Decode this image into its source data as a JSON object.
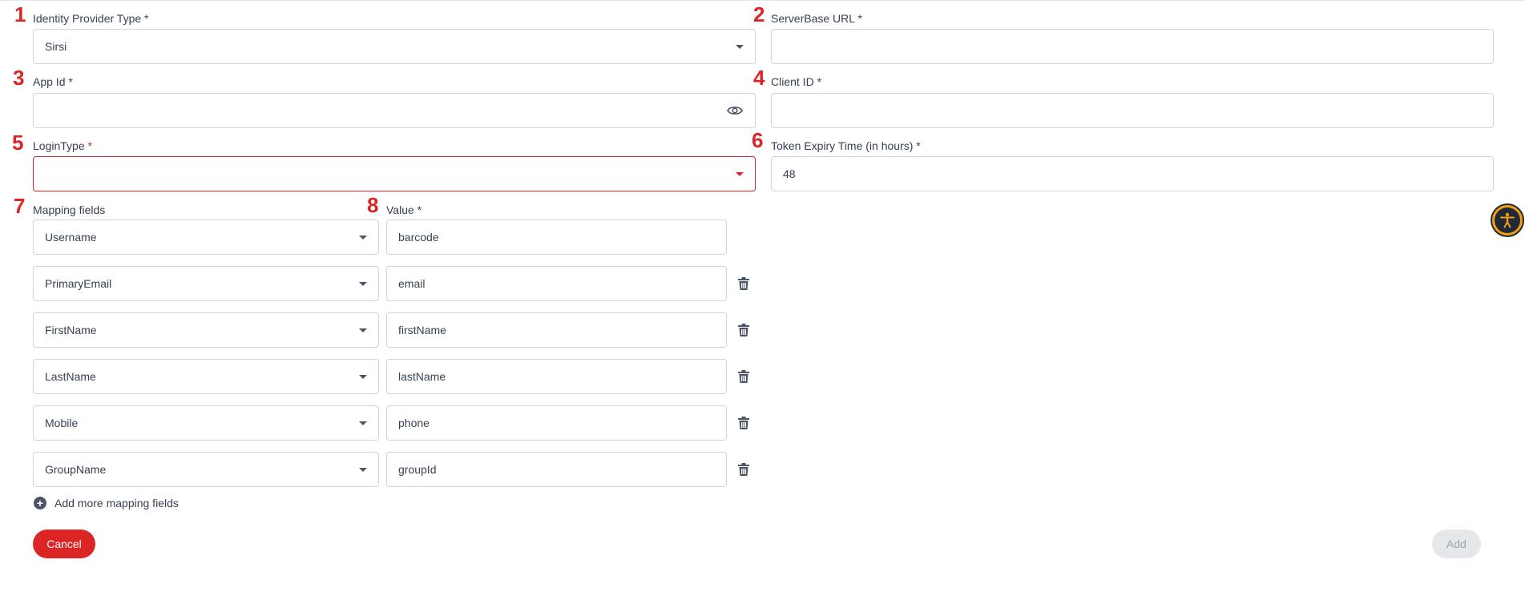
{
  "markers": [
    "1",
    "2",
    "3",
    "4",
    "5",
    "6",
    "7",
    "8"
  ],
  "identity_provider": {
    "label": "Identity Provider Type *",
    "value": "Sirsi"
  },
  "server_base_url": {
    "label": "ServerBase URL *",
    "value": ""
  },
  "app_id": {
    "label": "App Id *",
    "value": ""
  },
  "client_id": {
    "label": "Client ID *",
    "value": ""
  },
  "login_type": {
    "label": "LoginType",
    "required_mark": " *",
    "value": ""
  },
  "token_expiry": {
    "label": "Token Expiry Time (in hours) *",
    "value": "48"
  },
  "mapping": {
    "fields_label": "Mapping fields",
    "value_label": "Value *",
    "rows": [
      {
        "field": "Username",
        "value": "barcode"
      },
      {
        "field": "PrimaryEmail",
        "value": "email"
      },
      {
        "field": "FirstName",
        "value": "firstName"
      },
      {
        "field": "LastName",
        "value": "lastName"
      },
      {
        "field": "Mobile",
        "value": "phone"
      },
      {
        "field": "GroupName",
        "value": "groupId"
      }
    ],
    "add_more_label": "Add more mapping fields"
  },
  "buttons": {
    "cancel": "Cancel",
    "add": "Add"
  },
  "icons": {
    "eye": "eye-icon",
    "trash": "trash-icon",
    "plus": "plus-circle-icon",
    "accessibility": "accessibility-icon",
    "caret": "caret-down-icon"
  },
  "colors": {
    "accent_red": "#dc2626",
    "border": "#d1d5db",
    "disabled_button": "#e5e7eb",
    "accessibility_bg": "#f59e0b"
  }
}
